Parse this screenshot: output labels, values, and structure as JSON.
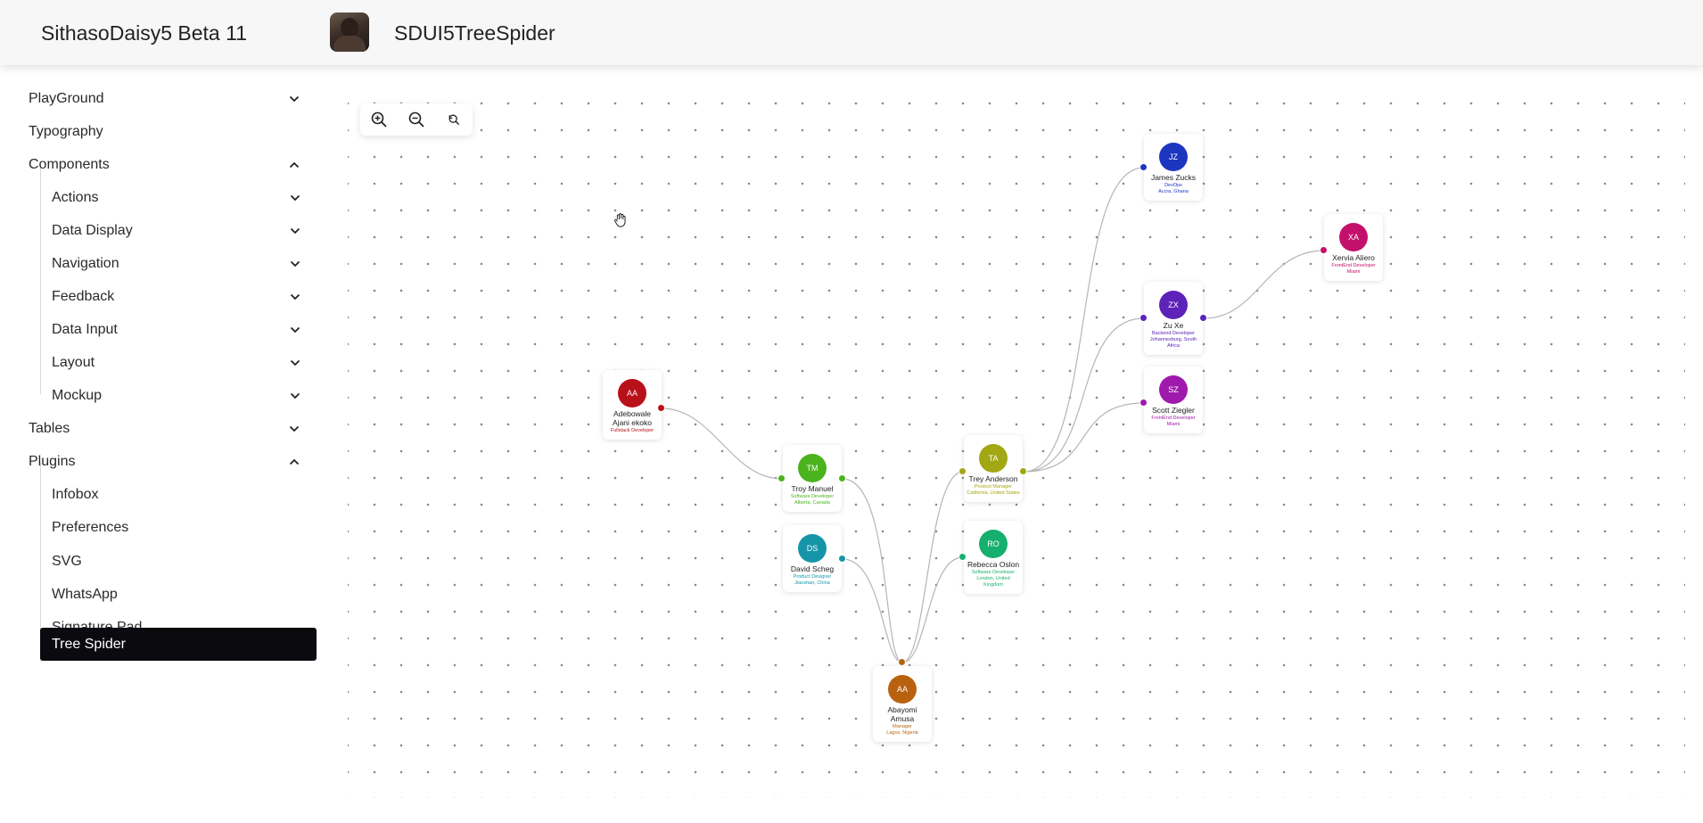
{
  "app": {
    "title": "SithasoDaisy5 Beta 11"
  },
  "page": {
    "title": "SDUI5TreeSpider"
  },
  "sidebar": {
    "items": [
      {
        "label": "PlayGround",
        "chevron": "down"
      },
      {
        "label": "Typography"
      },
      {
        "label": "Components",
        "chevron": "up"
      },
      {
        "label": "Actions",
        "chevron": "down"
      },
      {
        "label": "Data Display",
        "chevron": "down"
      },
      {
        "label": "Navigation",
        "chevron": "down"
      },
      {
        "label": "Feedback",
        "chevron": "down"
      },
      {
        "label": "Data Input",
        "chevron": "down"
      },
      {
        "label": "Layout",
        "chevron": "down"
      },
      {
        "label": "Mockup",
        "chevron": "down"
      },
      {
        "label": "Tables",
        "chevron": "down"
      },
      {
        "label": "Plugins",
        "chevron": "up"
      },
      {
        "label": "Infobox"
      },
      {
        "label": "Preferences"
      },
      {
        "label": "SVG"
      },
      {
        "label": "WhatsApp"
      },
      {
        "label": "Signature Pad"
      },
      {
        "label": "Tree Spider",
        "active": true
      }
    ]
  },
  "toolbar": {
    "zoom_in_icon": "zoom-in-icon",
    "zoom_out_icon": "zoom-out-icon",
    "reset_icon": "reset-zoom-icon"
  },
  "tree": {
    "nodes": [
      {
        "initials": "AA",
        "name": "Adebowale Ajani ekoko",
        "role": "Fullstack Developer",
        "location": "",
        "color": "#b8111a"
      },
      {
        "initials": "TM",
        "name": "Troy Manuel",
        "role": "Software Developer",
        "location": "Alberta, Canada",
        "color": "#4bb31d"
      },
      {
        "initials": "DS",
        "name": "David Scheg",
        "role": "Product Designer",
        "location": "Jiaoshan, China",
        "color": "#1695a8"
      },
      {
        "initials": "AA",
        "name": "Abayomi Amusa",
        "role": "Manager",
        "location": "Lagos, Nigeria",
        "color": "#b8620f"
      },
      {
        "initials": "TA",
        "name": "Trey Anderson",
        "role": "Product Manager",
        "location": "California, United States",
        "color": "#a2a714"
      },
      {
        "initials": "RO",
        "name": "Rebecca Oslon",
        "role": "Software Developer",
        "location": "London, United Kingdom",
        "color": "#16b06d"
      },
      {
        "initials": "JZ",
        "name": "James Zucks",
        "role": "DevOps",
        "location": "Accra, Ghana",
        "color": "#1c36c0"
      },
      {
        "initials": "ZX",
        "name": "Zu Xe",
        "role": "Backend Developer",
        "location": "Johannesburg, South Africa",
        "color": "#5d22b8"
      },
      {
        "initials": "SZ",
        "name": "Scott Ziegler",
        "role": "FrontEnd Developer",
        "location": "Miami",
        "color": "#a019ad"
      },
      {
        "initials": "XA",
        "name": "Xervia Aliero",
        "role": "FrontEnd Developer",
        "location": "Miami",
        "color": "#c3116b"
      }
    ],
    "edges": [
      [
        "Adebowale Ajani ekoko",
        "Troy Manuel"
      ],
      [
        "Troy Manuel",
        "Abayomi Amusa"
      ],
      [
        "David Scheg",
        "Abayomi Amusa"
      ],
      [
        "Abayomi Amusa",
        "Trey Anderson"
      ],
      [
        "Abayomi Amusa",
        "Rebecca Oslon"
      ],
      [
        "Trey Anderson",
        "James Zucks"
      ],
      [
        "Trey Anderson",
        "Zu Xe"
      ],
      [
        "Trey Anderson",
        "Scott Ziegler"
      ],
      [
        "Zu Xe",
        "Xervia Aliero"
      ]
    ],
    "link_color": "#b5b5b5"
  }
}
